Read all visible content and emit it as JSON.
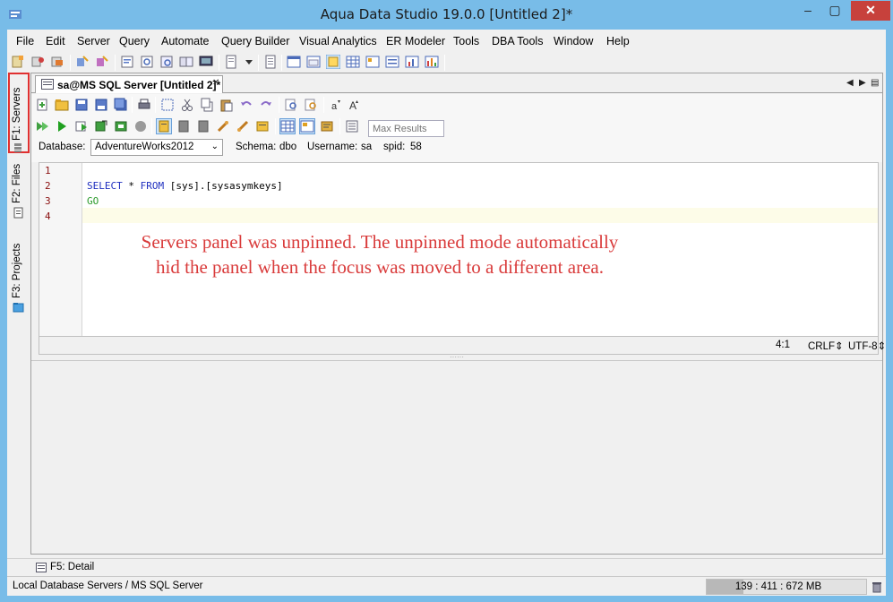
{
  "window": {
    "title": "Aqua Data Studio 19.0.0 [Untitled 2]*",
    "minimize_glyph": "–",
    "maximize_glyph": "▢",
    "close_glyph": "✕"
  },
  "menu": {
    "items": [
      "File",
      "Edit",
      "Server",
      "Query",
      "Automate",
      "Query Builder",
      "Visual Analytics",
      "ER Modeler",
      "Tools",
      "DBA Tools",
      "Window",
      "Help"
    ]
  },
  "side_tabs": [
    {
      "label": "F1: Servers",
      "icon": "servers-icon",
      "highlighted": true
    },
    {
      "label": "F2: Files",
      "icon": "files-icon"
    },
    {
      "label": "F3: Projects",
      "icon": "projects-icon"
    }
  ],
  "editor": {
    "tab_label": "sa@MS SQL Server [Untitled 2]*",
    "tab_close": "✕",
    "nav_prev": "◀",
    "nav_next": "▶",
    "nav_list": "▤",
    "max_results_placeholder": "Max Results",
    "database_label": "Database:",
    "database_value": "AdventureWorks2012",
    "schema_label": "Schema:",
    "schema_value": "dbo",
    "username_label": "Username:",
    "username_value": "sa",
    "spid_label": "spid:",
    "spid_value": "58",
    "line_numbers": [
      "1",
      "2",
      "3",
      "4"
    ],
    "code": {
      "select_kw": "SELECT",
      "star": " * ",
      "from_kw": "FROM",
      "target": " [sys].[sysasymkeys]",
      "go": "GO"
    },
    "annotation": "Servers panel was unpinned. The unpinned mode automatically hid the panel when the focus was moved to a different area.",
    "cursor_pos": "4:1",
    "line_ending": "CRLF",
    "encoding": "UTF-8",
    "spinner_glyph": "⇕"
  },
  "detail_bar": {
    "label": "F5: Detail"
  },
  "status": {
    "text": "Local Database Servers / MS SQL Server",
    "memory": "139 : 411 : 672 MB",
    "memory_fraction": 0.23
  },
  "colors": {
    "title_bar": "#78bce8",
    "close_button": "#c7413c",
    "annotation": "#d93b3b",
    "keyword": "#1f2fbf",
    "go_keyword": "#2a9a2a",
    "highlight_border": "#e03030"
  }
}
